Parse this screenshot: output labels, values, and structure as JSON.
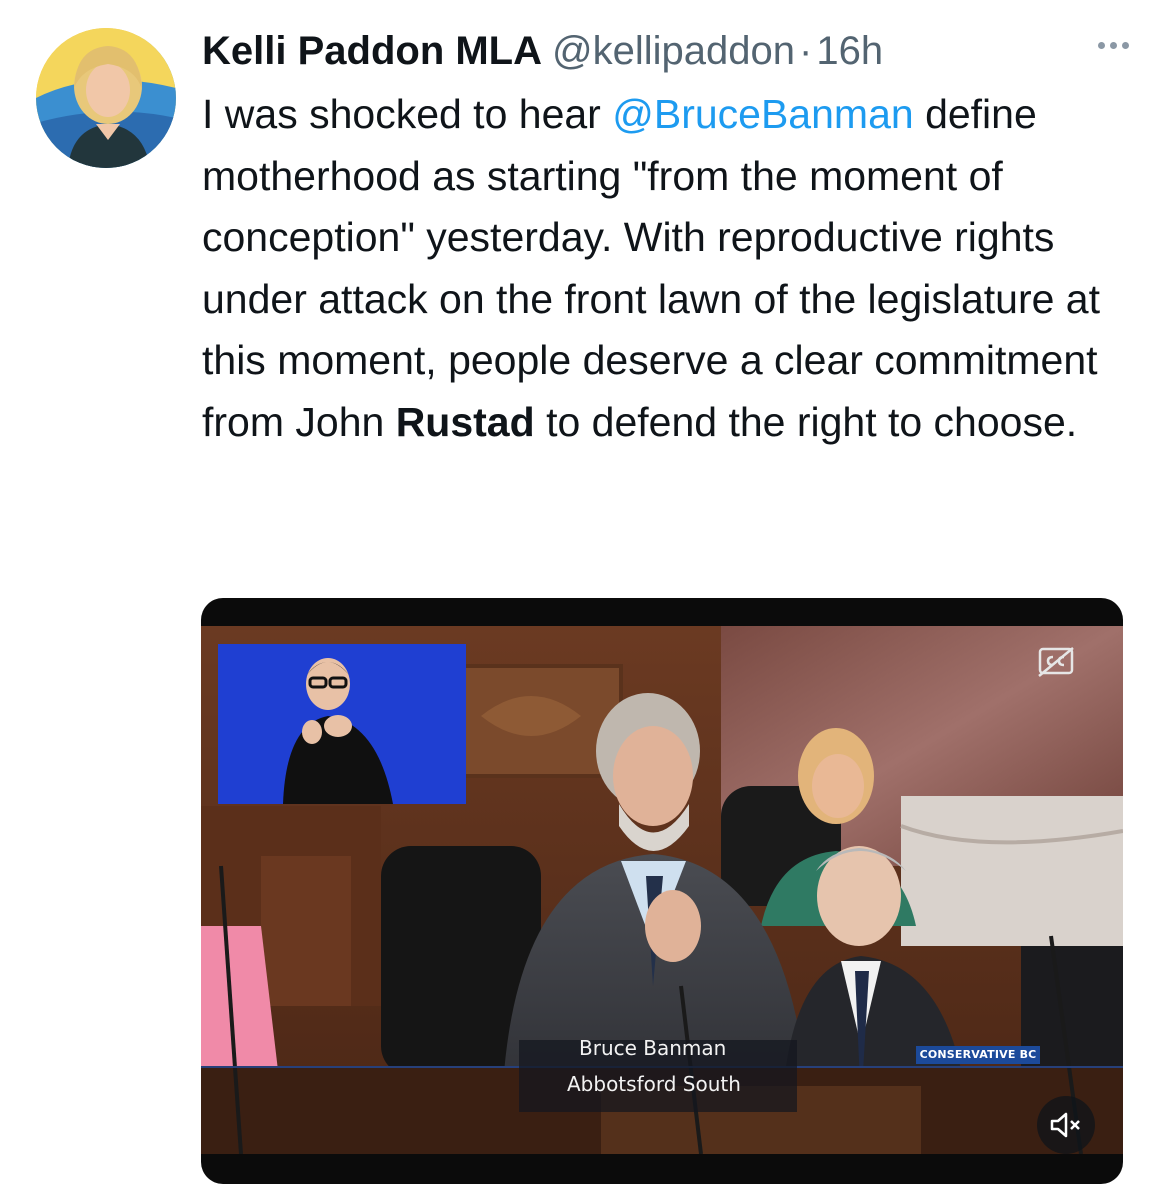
{
  "tweet": {
    "author": {
      "display_name": "Kelli Paddon MLA",
      "handle": "@kellipaddon",
      "separator": "·",
      "time": "16h"
    },
    "more_icon": "more-horizontal-icon",
    "text": {
      "part1": "I was shocked to hear ",
      "mention": "@BruceBanman",
      "part2": " define motherhood as starting \"from the moment of conception\" yesterday. With reproductive rights under attack on the front lawn of the legislature at this moment, people deserve a clear commitment from John ",
      "bold": "Rustad",
      "part3": " to defend the right to choose."
    },
    "colors": {
      "mention": "#1d9bf0",
      "secondary_text": "#536471",
      "primary_text": "#0f1419"
    }
  },
  "video": {
    "lower_third": {
      "name": "Bruce Banman",
      "riding": "Abbotsford South",
      "party": "CONSERVATIVE BC"
    },
    "cc_icon": "closed-captions-off-icon",
    "mute_icon": "volume-muted-icon"
  }
}
